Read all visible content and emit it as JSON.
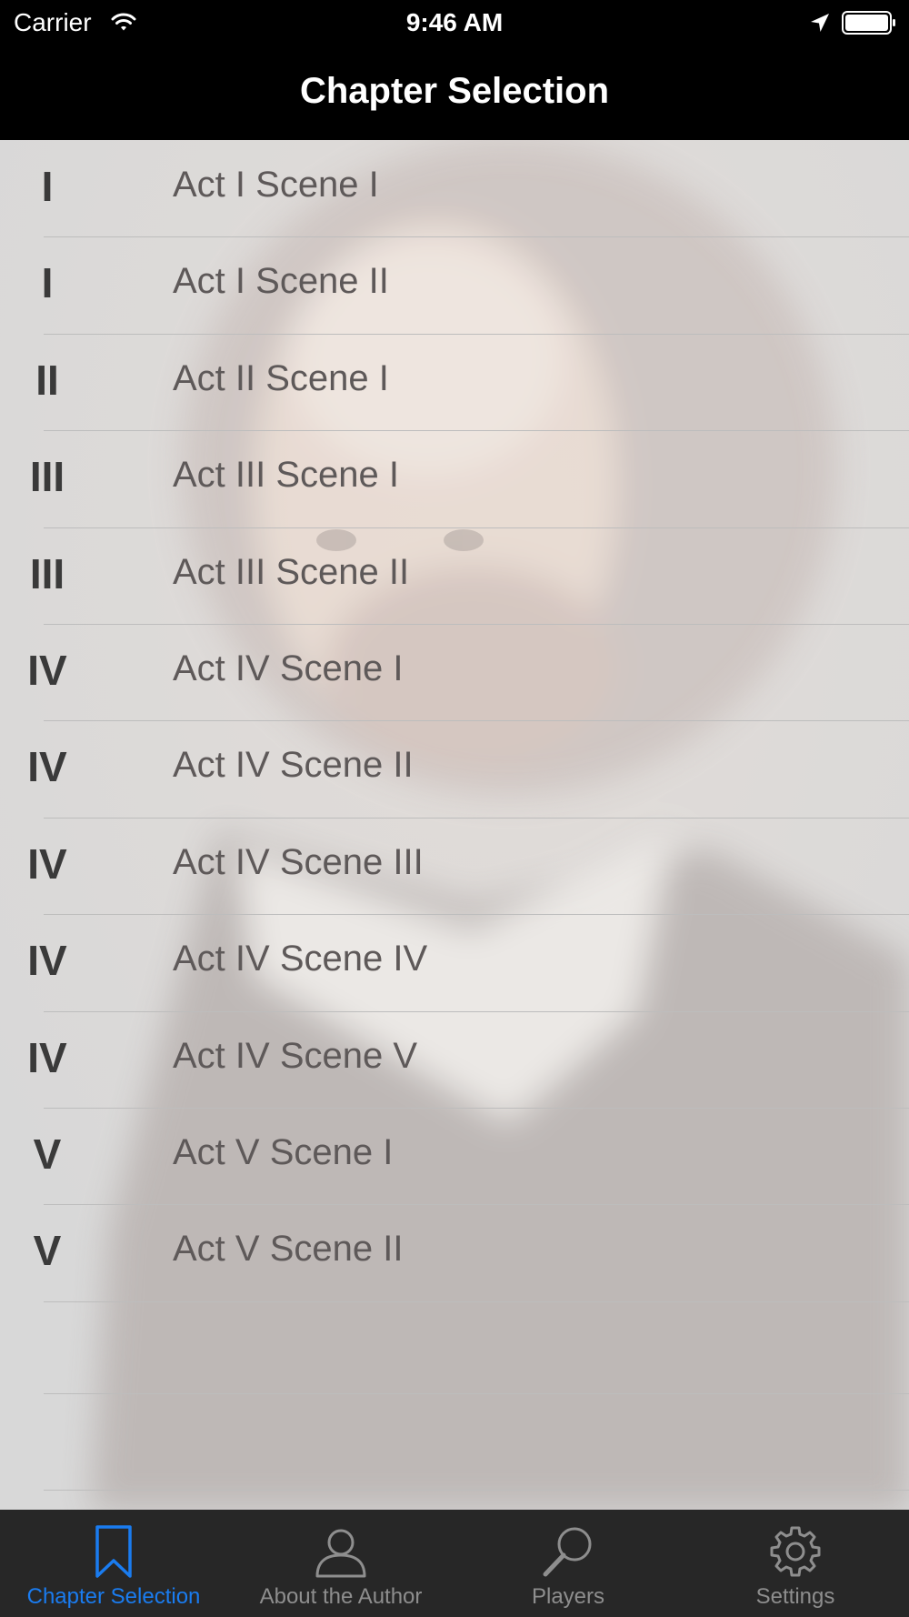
{
  "status_bar": {
    "carrier": "Carrier",
    "time": "9:46 AM",
    "icons": [
      "wifi-icon",
      "location-arrow-icon",
      "battery-icon"
    ]
  },
  "nav": {
    "title": "Chapter Selection"
  },
  "chapters": [
    {
      "num": "I",
      "label": "Act I Scene I"
    },
    {
      "num": "I",
      "label": "Act I Scene II"
    },
    {
      "num": "II",
      "label": "Act II Scene I"
    },
    {
      "num": "III",
      "label": "Act III Scene I"
    },
    {
      "num": "III",
      "label": "Act III Scene II"
    },
    {
      "num": "IV",
      "label": "Act IV Scene I"
    },
    {
      "num": "IV",
      "label": "Act IV Scene II"
    },
    {
      "num": "IV",
      "label": "Act IV Scene III"
    },
    {
      "num": "IV",
      "label": "Act IV Scene IV"
    },
    {
      "num": "IV",
      "label": "Act IV Scene V"
    },
    {
      "num": "V",
      "label": "Act V Scene I"
    },
    {
      "num": "V",
      "label": "Act V Scene II"
    }
  ],
  "tabs": [
    {
      "label": "Chapter Selection",
      "icon": "bookmark-icon",
      "active": true
    },
    {
      "label": "About the Author",
      "icon": "person-icon",
      "active": false
    },
    {
      "label": "Players",
      "icon": "magnifier-icon",
      "active": false
    },
    {
      "label": "Settings",
      "icon": "gear-icon",
      "active": false
    }
  ],
  "colors": {
    "accent": "#1a7cf0",
    "tab_bar": "#272727",
    "inactive_tab": "#8e8e8e"
  }
}
